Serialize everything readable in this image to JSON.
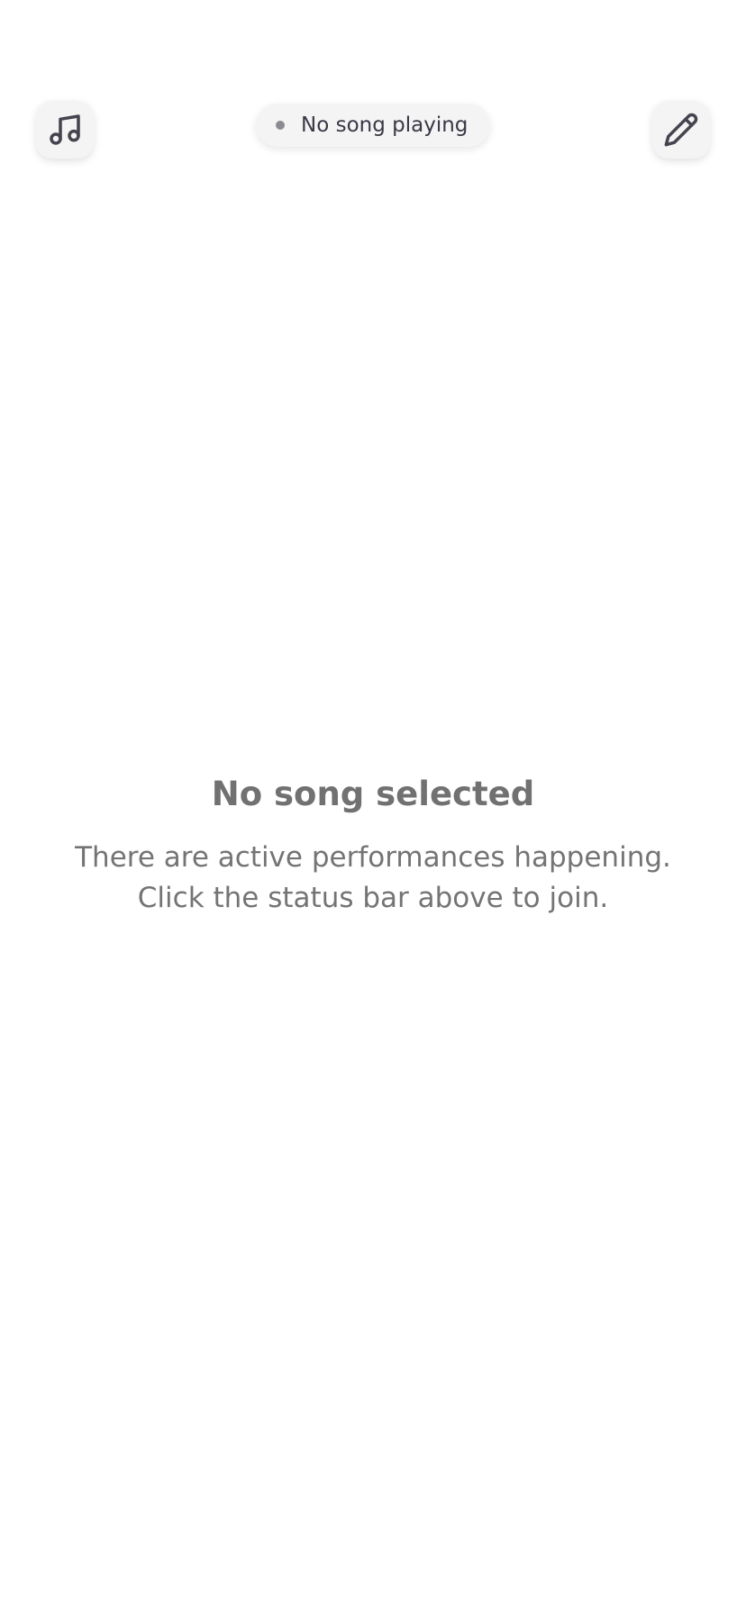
{
  "header": {
    "left_button": {
      "icon": "music-note-icon"
    },
    "right_button": {
      "icon": "pencil-icon"
    },
    "status": {
      "text": "No song playing",
      "dot_color": "#8c8b91"
    }
  },
  "main": {
    "empty_title": "No song selected",
    "empty_message": "There are active performances happening. Click the status bar above to join."
  }
}
